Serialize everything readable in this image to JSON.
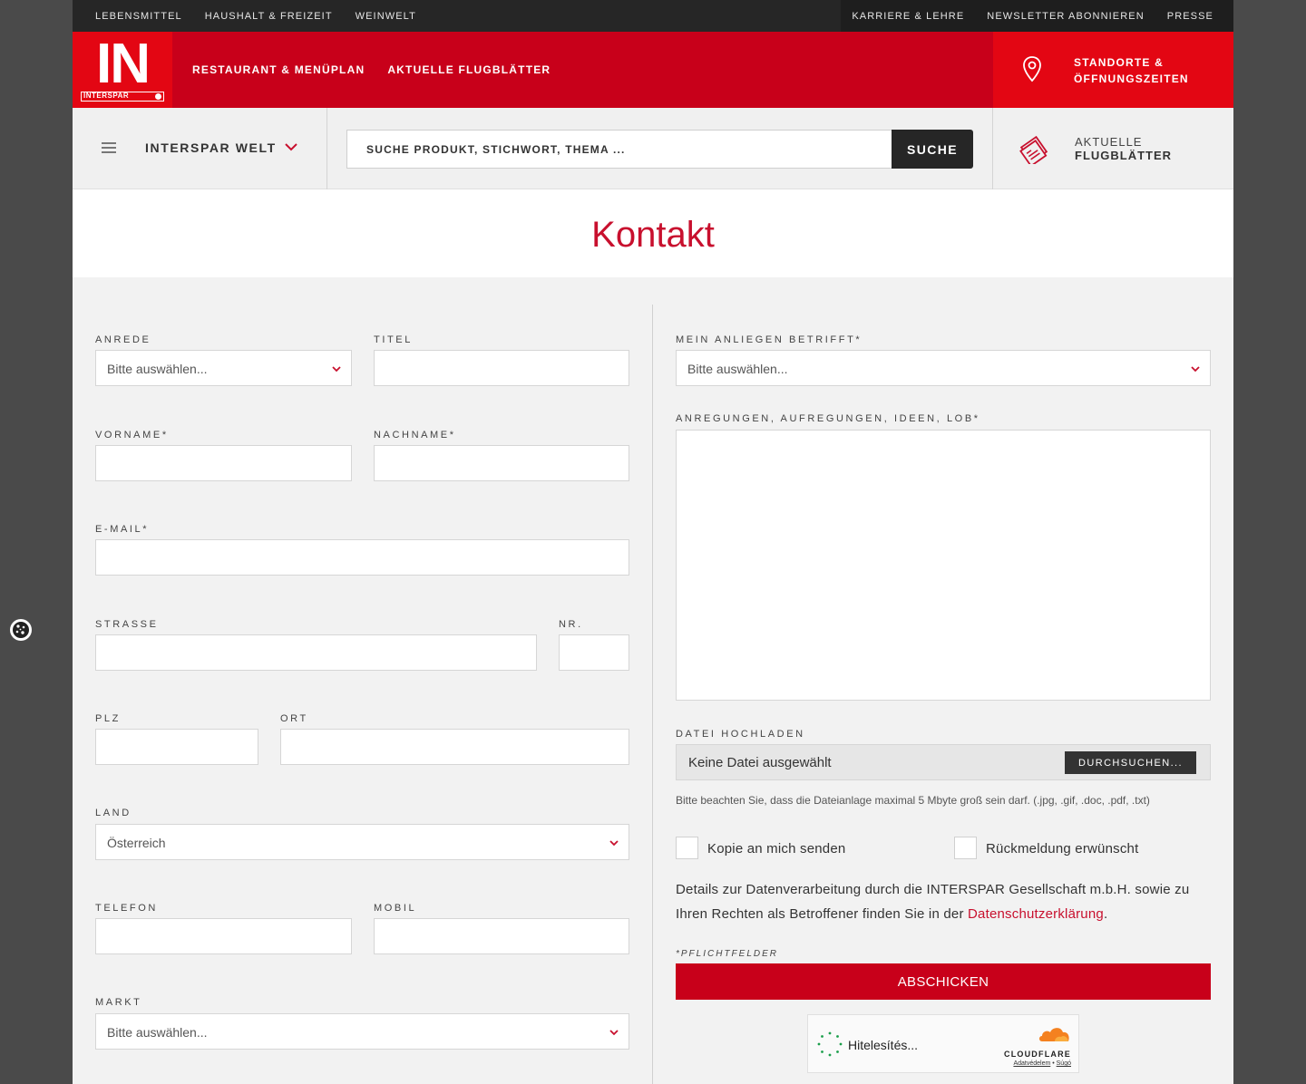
{
  "topbar": {
    "left_links": [
      "LEBENSMITTEL",
      "HAUSHALT & FREIZEIT",
      "WEINWELT"
    ],
    "right_links": [
      "KARRIERE & LEHRE",
      "NEWSLETTER ABONNIEREN",
      "PRESSE"
    ]
  },
  "header": {
    "logo_text": "IN",
    "logo_subtext": "INTERSPAR",
    "nav": [
      "RESTAURANT & MENÜPLAN",
      "AKTUELLE FLUGBLÄTTER"
    ],
    "standorte_line1": "STANDORTE &",
    "standorte_line2": "ÖFFNUNGSZEITEN",
    "accent_color": "#c8001a"
  },
  "subheader": {
    "menu_label": "INTERSPAR WELT",
    "search_placeholder": "SUCHE PRODUKT, STICHWORT, THEMA ...",
    "search_button": "SUCHE",
    "flyer_line1": "AKTUELLE",
    "flyer_line2": "FLUGBLÄTTER"
  },
  "page": {
    "title": "Kontakt"
  },
  "form": {
    "anrede": {
      "label": "ANREDE",
      "value": "Bitte auswählen..."
    },
    "titel": {
      "label": "TITEL",
      "value": ""
    },
    "vorname": {
      "label": "VORNAME*",
      "value": ""
    },
    "nachname": {
      "label": "NACHNAME*",
      "value": ""
    },
    "email": {
      "label": "E-MAIL*",
      "value": ""
    },
    "strasse": {
      "label": "STRASSE",
      "value": ""
    },
    "nr": {
      "label": "NR.",
      "value": ""
    },
    "plz": {
      "label": "PLZ",
      "value": ""
    },
    "ort": {
      "label": "ORT",
      "value": ""
    },
    "land": {
      "label": "LAND",
      "value": "Österreich"
    },
    "telefon": {
      "label": "TELEFON",
      "value": ""
    },
    "mobil": {
      "label": "MOBIL",
      "value": ""
    },
    "markt": {
      "label": "MARKT",
      "value": "Bitte auswählen..."
    },
    "anliegen": {
      "label": "MEIN ANLIEGEN BETRIFFT*",
      "value": "Bitte auswählen..."
    },
    "nachricht": {
      "label": "ANREGUNGEN, AUFREGUNGEN, IDEEN, LOB*",
      "value": ""
    },
    "upload": {
      "label": "DATEI HOCHLADEN",
      "status": "Keine Datei ausgewählt",
      "button": "DURCHSUCHEN...",
      "note": "Bitte beachten Sie, dass die Dateianlage maximal 5 Mbyte groß sein darf. (.jpg, .gif, .doc, .pdf, .txt)"
    },
    "kopie_label": "Kopie an mich senden",
    "rueckmeldung_label": "Rückmeldung erwünscht",
    "privacy_text": "Details zur Datenverarbeitung durch die INTERSPAR Gesellschaft m.b.H. sowie zu Ihren Rechten als Betroffener finden Sie in der ",
    "privacy_link": "Datenschutzerklärung",
    "privacy_end": ".",
    "pflicht": "*PFLICHTFELDER",
    "submit": "ABSCHICKEN"
  },
  "captcha": {
    "status": "Hitelesítés...",
    "brand": "CLOUDFLARE",
    "link_privacy": "Adatvédelem",
    "link_sep": " • ",
    "link_help": "Súgó"
  },
  "icons": {
    "pin": "location-pin-icon",
    "hamburger": "hamburger-menu-icon",
    "chevron": "chevron-down-icon",
    "flyer": "flyer-icon",
    "cookie": "cookie-icon"
  }
}
